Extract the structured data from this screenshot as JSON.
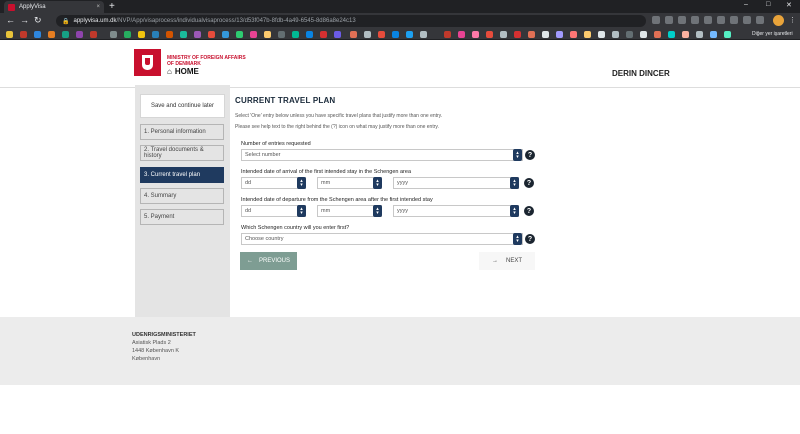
{
  "browser": {
    "tab_title": "ApplyVisa",
    "tab_close": "×",
    "new_tab": "+",
    "url_host": "applyvisa.um.dk",
    "url_path": "/NVP/App/visaprocess/individualvisaprocess/13/d53f047b-8fdb-4a49-6545-8d86a8e24c13",
    "other_bookmarks": "Diğer yer işaretleri",
    "window_controls": [
      "–",
      "□",
      "✕"
    ]
  },
  "header": {
    "ministry_line1": "MINISTRY OF FOREIGN AFFAIRS",
    "ministry_line2": "OF DENMARK",
    "home_label": "HOME",
    "user_name": "DERIN DINCER"
  },
  "sidebar": {
    "save_label": "Save and continue later",
    "steps": [
      {
        "label": "1. Personal information"
      },
      {
        "label": "2. Travel documents & history"
      },
      {
        "label": "3. Current travel plan"
      },
      {
        "label": "4. Summary"
      },
      {
        "label": "5. Payment"
      }
    ]
  },
  "main": {
    "title": "CURRENT TRAVEL PLAN",
    "intro1": "Select 'One' entry below unless you have specific travel plans that justify more than one entry.",
    "intro2": "Please see help text to the right behind the (?) icon on what may justify more than one entry.",
    "entries_label": "Number of entries requested",
    "entries_value": "Select number",
    "arrival_label": "Intended date of arrival of the first intended stay in the Schengen area",
    "departure_label": "Intended date of departure from the Schengen area after the first intended stay",
    "day_placeholder": "dd",
    "month_placeholder": "mm",
    "year_placeholder": "yyyy",
    "country_label": "Which Schengen country will you enter first?",
    "country_value": "Choose country",
    "help_symbol": "?",
    "previous_label": "PREVIOUS",
    "next_label": "NEXT"
  },
  "footer": {
    "org": "UDENRIGSMINISTERIET",
    "address1": "Asiatisk Plads 2",
    "address2": "1448 København K",
    "address3": "København"
  },
  "colors": {
    "brand_red": "#c8102e",
    "nav_active": "#1f3a5f",
    "previous_button": "#7e9d93"
  }
}
